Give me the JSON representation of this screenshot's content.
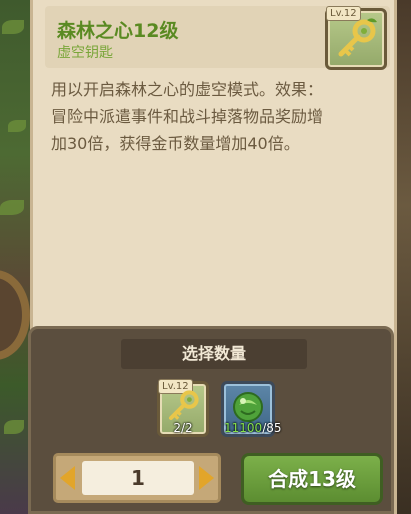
{
  "item": {
    "title": "森林之心12级",
    "subtitle": "虚空钥匙",
    "level_badge": "Lv.12",
    "icon": "golden-key-icon",
    "description_lines": [
      "用以开启森林之心的虚空模式。效果：",
      "冒险中派遣事件和战斗掉落物品奖励增",
      "加30倍，获得金币数量增加40倍。"
    ]
  },
  "select": {
    "title": "选择数量",
    "materials": [
      {
        "icon": "golden-key-icon",
        "level_badge": "Lv.12",
        "have": "2",
        "need": "/2"
      },
      {
        "icon": "green-orb-icon",
        "have": "11100",
        "need": "/85"
      }
    ],
    "quantity": "1",
    "craft_label": "合成13级"
  },
  "colors": {
    "title_green": "#5a8a22",
    "parchment": "#e9dcc2",
    "button_green": "#6a9e3c",
    "arrow_gold": "#e2a52a"
  }
}
